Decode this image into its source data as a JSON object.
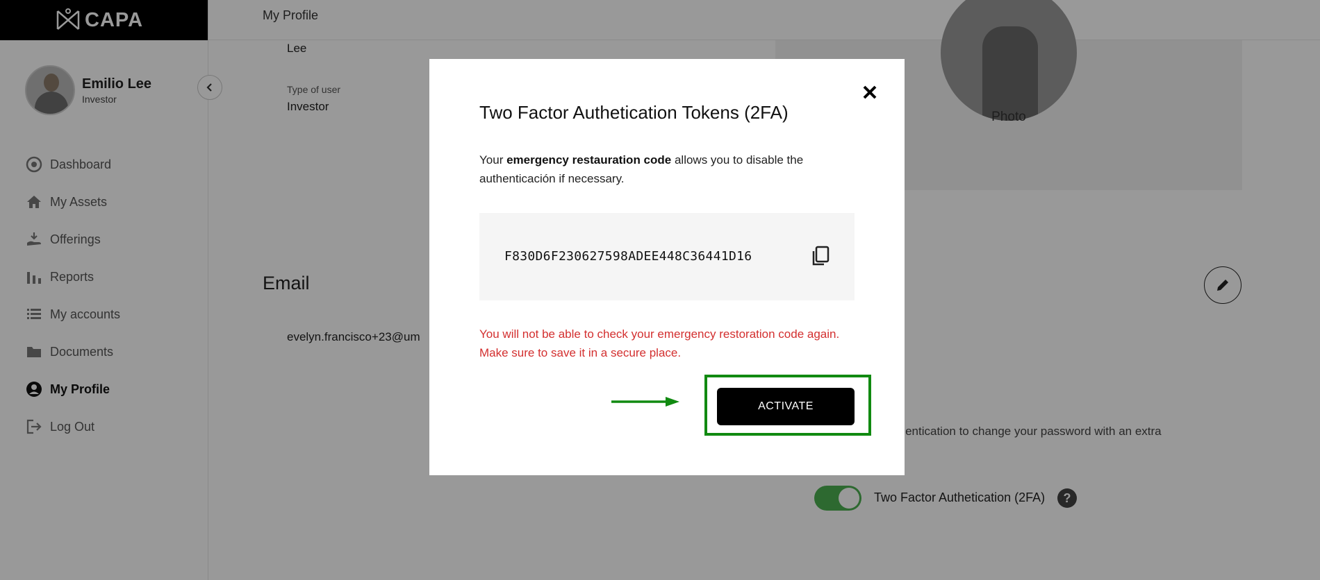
{
  "app": {
    "logo_text": "CAPA"
  },
  "user": {
    "name": "Emilio Lee",
    "role": "Investor"
  },
  "sidebar": {
    "items": [
      {
        "label": "Dashboard",
        "icon": "dashboard-icon"
      },
      {
        "label": "My Assets",
        "icon": "home-icon"
      },
      {
        "label": "Offerings",
        "icon": "offerings-icon"
      },
      {
        "label": "Reports",
        "icon": "bar-chart-icon"
      },
      {
        "label": "My accounts",
        "icon": "list-icon"
      },
      {
        "label": "Documents",
        "icon": "folder-icon"
      },
      {
        "label": "My Profile",
        "icon": "user-circle-icon",
        "active": true
      },
      {
        "label": "Log Out",
        "icon": "logout-icon"
      }
    ]
  },
  "header": {
    "breadcrumb": "My Profile"
  },
  "profile": {
    "last_name_value": "Lee",
    "type_of_user_label": "Type of user",
    "type_of_user_value": "Investor",
    "photo_label": "Photo",
    "email_section_title": "Email",
    "email_value": "evelyn.francisco+23@um",
    "twofa_description": "authentication to change your password with an extra",
    "twofa_toggle_label": "Two Factor Authetication (2FA)",
    "twofa_enabled": true,
    "help_symbol": "?"
  },
  "modal": {
    "title": "Two Factor Authetication Tokens (2FA)",
    "desc_prefix": "Your ",
    "desc_bold": "emergency restauration code",
    "desc_suffix": " allows you to disable the authenticación if necessary.",
    "code": "F830D6F230627598ADEE448C36441D16",
    "warning": "You will not be able to check your emergency restoration code again. Make sure to save it in a secure place.",
    "activate_label": "ACTIVATE"
  },
  "colors": {
    "sidebar_active": "#111111",
    "toggle_on": "#4caf50",
    "warning": "#d32f2f",
    "highlight": "#118a11",
    "button_bg": "#000000"
  }
}
